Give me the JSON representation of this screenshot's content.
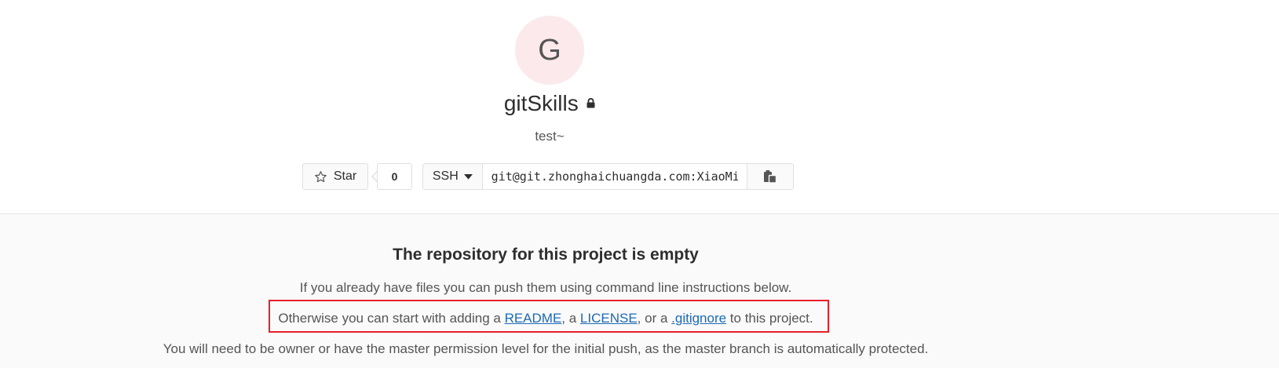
{
  "project": {
    "avatar_letter": "G",
    "name": "gitSkills",
    "description": "test~"
  },
  "actions": {
    "star_label": "Star",
    "star_count": "0",
    "clone_protocol": "SSH",
    "clone_url": "git@git.zhonghaichuangda.com:XiaoMing/gitSkills.git"
  },
  "empty_state": {
    "title": "The repository for this project is empty",
    "line1": "If you already have files you can push them using command line instructions below.",
    "line2_prefix": "Otherwise you can start with adding a ",
    "readme_link": "README",
    "sep1": ", a ",
    "license_link": "LICENSE",
    "sep2": ", or a ",
    "gitignore_link": ".gitignore",
    "line2_suffix": " to this project.",
    "line3": "You will need to be owner or have the master permission level for the initial push, as the master branch is automatically protected."
  },
  "colors": {
    "avatar_bg": "#fbe9eb",
    "link": "#1b69b6",
    "highlight": "#e8202a"
  },
  "icons": {
    "lock": "lock-icon",
    "star": "star-icon",
    "caret": "caret-down-icon",
    "copy": "clipboard-icon"
  }
}
